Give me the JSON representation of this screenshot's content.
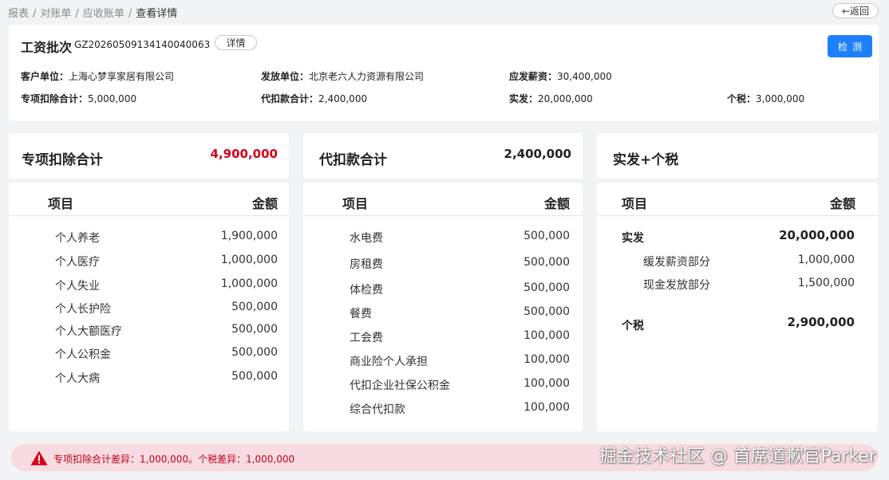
{
  "breadcrumb": {
    "items": [
      "报表",
      "对账单",
      "应收账单"
    ],
    "current": "查看详情",
    "separator": "/"
  },
  "back_button": {
    "label": "←返回"
  },
  "header": {
    "batch_label": "工资批次",
    "batch_id": "GZ20260509134140040063",
    "detail_button": "详情",
    "check_button": "检测",
    "fields": {
      "customer_label": "客户单位：",
      "customer_value": "上海心梦享家居有限公司",
      "issuer_label": "发放单位：",
      "issuer_value": "北京老六人力资源有限公司",
      "payable_label": "应发薪资：",
      "payable_value": "30,400,000",
      "special_label": "专项扣除合计：",
      "special_value": "5,000,000",
      "withhold_label": "代扣款合计：",
      "withhold_value": "2,400,000",
      "actual_label": "实发：",
      "actual_value": "20,000,000",
      "tax_label": "个税：",
      "tax_value": "3,000,000"
    }
  },
  "columns": {
    "special": {
      "title": "专项扣除合计",
      "total": "4,900,000",
      "header_item": "项目",
      "header_amount": "金额",
      "rows": [
        {
          "label": "个人养老",
          "value": "1,900,000"
        },
        {
          "label": "个人医疗",
          "value": "1,000,000"
        },
        {
          "label": "个人失业",
          "value": "1,000,000"
        },
        {
          "label": "个人长护险",
          "value": "500,000"
        },
        {
          "label": "个人大额医疗",
          "value": "500,000"
        },
        {
          "label": "个人公积金",
          "value": "500,000"
        },
        {
          "label": "个人大病",
          "value": "500,000"
        }
      ]
    },
    "withhold": {
      "title": "代扣款合计",
      "total": "2,400,000",
      "header_item": "项目",
      "header_amount": "金额",
      "rows": [
        {
          "label": "水电费",
          "value": "500,000"
        },
        {
          "label": "房租费",
          "value": "500,000"
        },
        {
          "label": "体检费",
          "value": "500,000"
        },
        {
          "label": "餐费",
          "value": "500,000"
        },
        {
          "label": "工会费",
          "value": "100,000"
        },
        {
          "label": "商业险个人承担",
          "value": "100,000"
        },
        {
          "label": "代扣企业社保公积金",
          "value": "100,000"
        },
        {
          "label": "综合代扣款",
          "value": "100,000"
        }
      ]
    },
    "actual_tax": {
      "title": "实发+个税",
      "header_item": "项目",
      "header_amount": "金额",
      "actual_label": "实发",
      "actual_value": "20,000,000",
      "sub_rows": [
        {
          "label": "缓发薪资部分",
          "value": "1,000,000"
        },
        {
          "label": "现金发放部分",
          "value": "1,500,000"
        }
      ],
      "tax_label": "个税",
      "tax_value": "2,900,000"
    }
  },
  "alert": {
    "message": "专项扣除合计差异：1,000,000。个税差异：1,000,000",
    "icon": "warning-icon"
  },
  "watermark": "掘金技术社区 @ 首席道歉官Parker",
  "colors": {
    "accent": "#1e80ff",
    "danger": "#d4001a",
    "alert_bg": "#f7dbe0",
    "page_bg": "#f2f3f5"
  }
}
